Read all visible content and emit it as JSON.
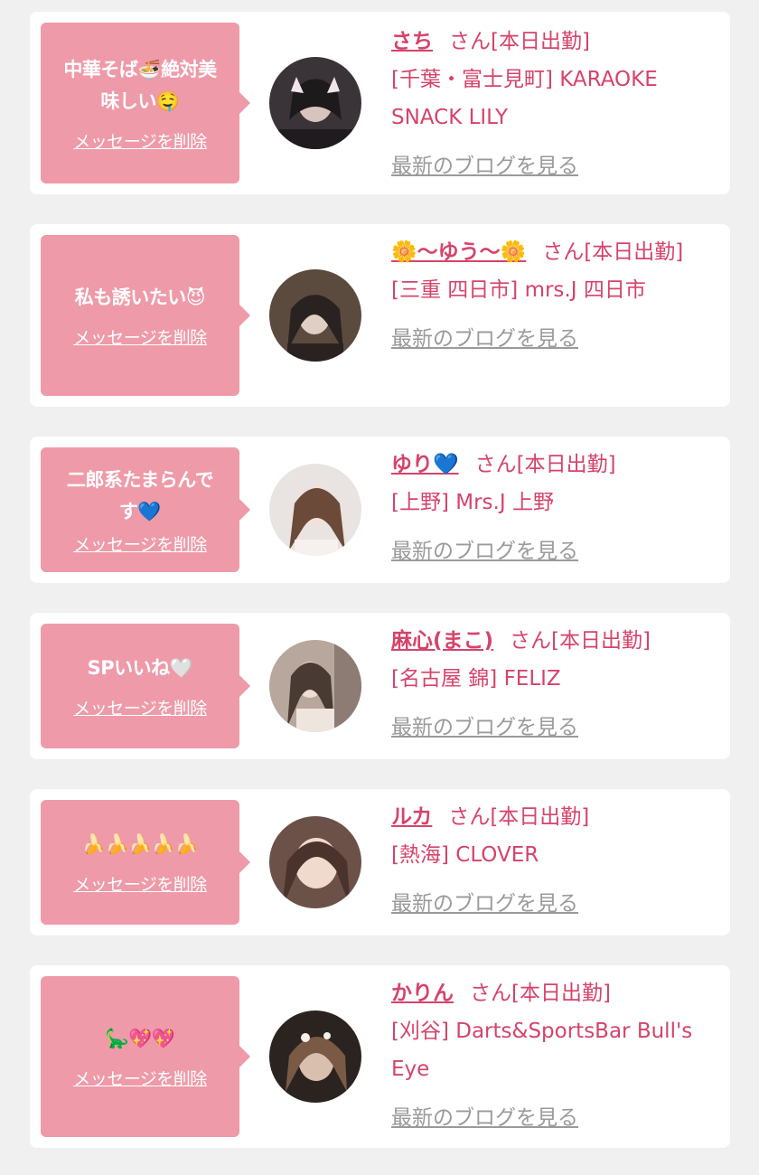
{
  "delete_label": "メッセージを削除",
  "blog_label": "最新のブログを見る",
  "colors": {
    "background": "#f0f0f0",
    "bubble": "#ee9aa9",
    "accent_pink": "#d6436a",
    "link_gray": "#9a9a9a"
  },
  "messages": [
    {
      "message_line1": "中華そば🍜絶対美",
      "message_line2": "味しい🤤",
      "name": "さち",
      "suffix": "さん[本日出勤]",
      "shop": "[千葉・富士見町] KARAOKE SNACK LILY",
      "avatar_icon": "avatar-photo"
    },
    {
      "message_line1": "私も誘いたい😈",
      "message_line2": "",
      "name": "🌼〜ゆう〜🌼",
      "suffix": "さん[本日出勤]",
      "shop": "[三重 四日市] mrs.J 四日市",
      "avatar_icon": "avatar-photo"
    },
    {
      "message_line1": "二郎系たまらんで",
      "message_line2": "す💙",
      "name": "ゆり💙",
      "suffix": "さん[本日出勤]",
      "shop": "[上野] Mrs.J 上野",
      "avatar_icon": "avatar-photo"
    },
    {
      "message_line1": "SPいいね🤍",
      "message_line2": "",
      "name": "麻心(まこ)",
      "suffix": "さん[本日出勤]",
      "shop": "[名古屋 錦] FELIZ",
      "avatar_icon": "avatar-photo"
    },
    {
      "message_line1": "🍌🍌🍌🍌🍌",
      "message_line2": "",
      "name": "ルカ",
      "suffix": "さん[本日出勤]",
      "shop": "[熱海] CLOVER",
      "avatar_icon": "avatar-photo"
    },
    {
      "message_line1": "🦕💖💖",
      "message_line2": "",
      "name": "かりん",
      "suffix": "さん[本日出勤]",
      "shop": "[刈谷] Darts&SportsBar Bull's Eye",
      "avatar_icon": "avatar-photo"
    }
  ]
}
